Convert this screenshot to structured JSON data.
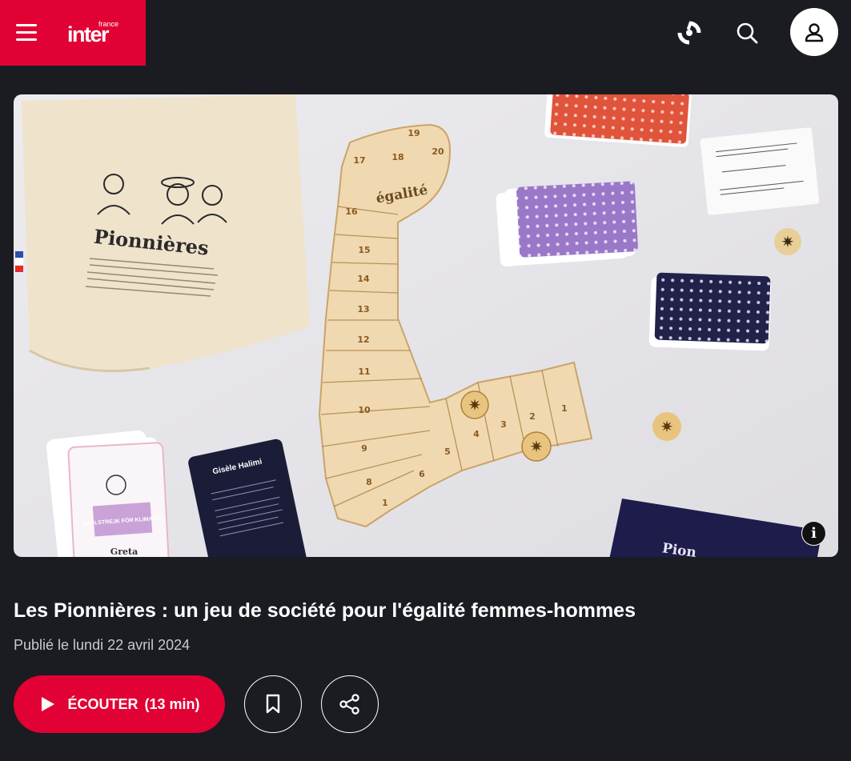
{
  "header": {
    "logo_small": "france",
    "logo_main": "inter",
    "brand_color": "#e20134",
    "icons": [
      "menu-icon",
      "live-radio-icon",
      "search-icon",
      "user-icon"
    ]
  },
  "article": {
    "title": "Les Pionnières : un jeu de société pour l'égalité femmes-hommes",
    "date": "Publié le lundi 22 avril 2024"
  },
  "image": {
    "bag_title": "Pionnières",
    "arm_label": "égalité",
    "arm_numbers": [
      "1",
      "2",
      "3",
      "4",
      "5",
      "6",
      "7",
      "8",
      "9",
      "10",
      "11",
      "12",
      "13",
      "14",
      "15",
      "16",
      "17",
      "18",
      "19",
      "20"
    ],
    "card_labels": [
      "Gisèle Halimi",
      "SKOLSTREJK FÖR KLIMATET",
      "Greta",
      "Pion"
    ]
  },
  "player": {
    "listen_label": "ÉCOUTER",
    "duration": "(13 min)"
  }
}
